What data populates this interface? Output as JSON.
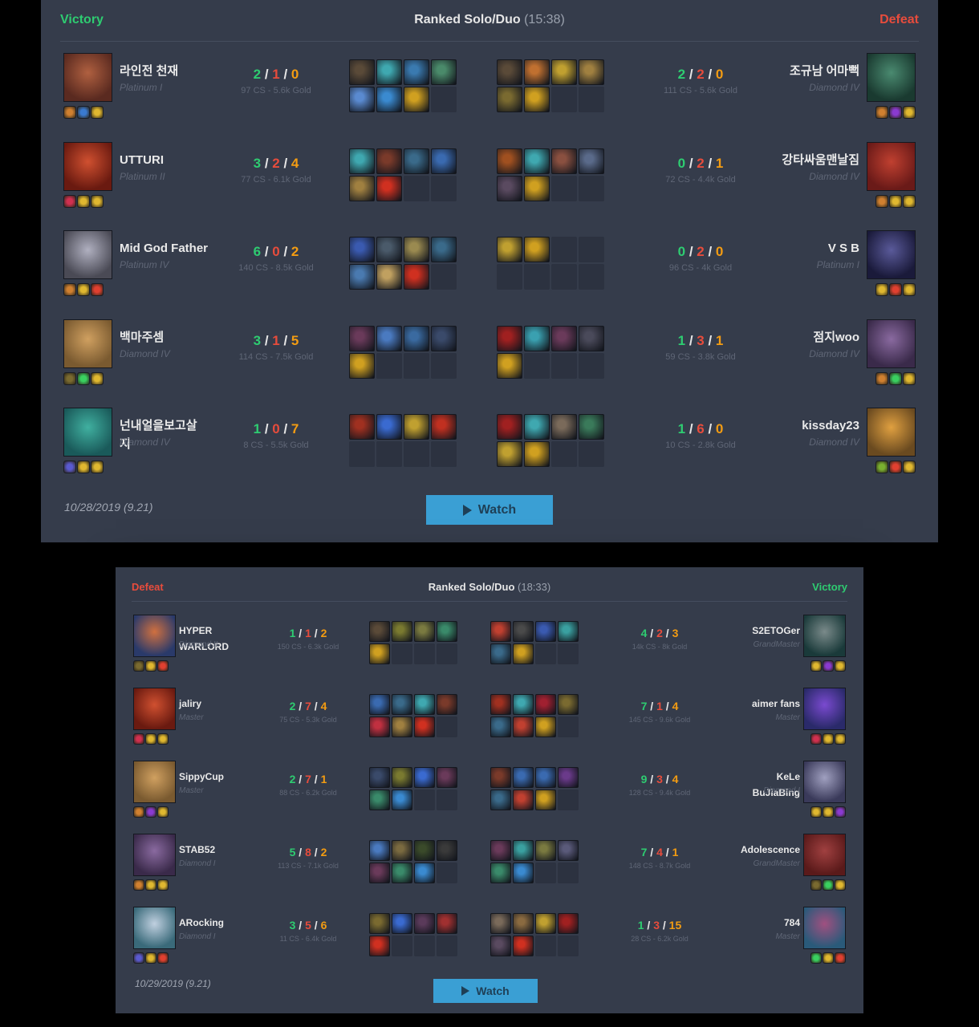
{
  "matches": [
    {
      "result_left": "Victory",
      "result_right": "Defeat",
      "left_win": true,
      "queue": "Ranked Solo/Duo",
      "duration": "(15:38)",
      "date": "10/28/2019 (9.21)",
      "watch_label": "Watch",
      "rows": [
        {
          "left": {
            "name": "라인전 천재",
            "rank": "Platinum I",
            "kills": "2",
            "deaths": "1",
            "assists": "0",
            "cs_gold": "97 CS - 5.6k Gold",
            "avatar_colors": [
              "#5a2a20",
              "#b06040"
            ],
            "summoners": [
              "#d08030",
              "#3a7ad0",
              "#e0b830"
            ],
            "items": [
              "#5a4a38",
              "#3fa8b0",
              "#3a7ab0",
              "#4a8a6a",
              "#5a8ad0",
              "#3a8ad0",
              "#d0a020",
              "",
              ""
            ]
          },
          "right": {
            "name": "조규남 어마뻑",
            "rank": "Diamond IV",
            "kills": "2",
            "deaths": "2",
            "assists": "0",
            "cs_gold": "111 CS - 5.6k Gold",
            "avatar_colors": [
              "#1a3a30",
              "#4a8a70"
            ],
            "summoners": [
              "#d08030",
              "#8a3ad0",
              "#e0b830"
            ],
            "items": [
              "#5a4a38",
              "#c07030",
              "#c0a030",
              "#a08040",
              "#7a6a30",
              "#d0a020",
              "",
              ""
            ]
          }
        },
        {
          "left": {
            "name": "UTTURI",
            "rank": "Platinum II",
            "kills": "3",
            "deaths": "2",
            "assists": "4",
            "cs_gold": "77 CS - 6.1k Gold",
            "avatar_colors": [
              "#6a1a10",
              "#d05030"
            ],
            "summoners": [
              "#d03050",
              "#e0b830",
              "#e0b830"
            ],
            "items": [
              "#3fa8b0",
              "#7a3a2a",
              "#3a6a8a",
              "#3a6ab0",
              "#a08040",
              "#d03020",
              "",
              ""
            ]
          },
          "right": {
            "name": "강타싸움맨날짐",
            "rank": "Diamond IV",
            "kills": "0",
            "deaths": "2",
            "assists": "1",
            "cs_gold": "72 CS - 4.4k Gold",
            "avatar_colors": [
              "#6a1a18",
              "#c04030"
            ],
            "summoners": [
              "#d08030",
              "#e0b830",
              "#e0b830"
            ],
            "items": [
              "#a05020",
              "#3fa8b0",
              "#8a5040",
              "#5a6a8a",
              "#5a4a60",
              "#d0a020",
              "",
              ""
            ]
          }
        },
        {
          "left": {
            "name": "Mid God Father",
            "rank": "Platinum IV",
            "kills": "6",
            "deaths": "0",
            "assists": "2",
            "cs_gold": "140 CS - 8.5k Gold",
            "avatar_colors": [
              "#4a4a55",
              "#b0b0c0"
            ],
            "summoners": [
              "#d08030",
              "#e0b830",
              "#e04030"
            ],
            "items": [
              "#3a5ab0",
              "#4a5a6a",
              "#9a8a50",
              "#3a6a8a",
              "#4a7ab0",
              "#c0a060",
              "#d03020",
              ""
            ]
          },
          "right": {
            "name": "V S B",
            "rank": "Platinum I",
            "kills": "0",
            "deaths": "2",
            "assists": "0",
            "cs_gold": "96 CS - 4k Gold",
            "avatar_colors": [
              "#1a1a3a",
              "#5a5a9a"
            ],
            "summoners": [
              "#e0b830",
              "#e04030",
              "#e0b830"
            ],
            "items": [
              "#c0a030",
              "#d0a020",
              "",
              "",
              "",
              "",
              "",
              ""
            ]
          }
        },
        {
          "left": {
            "name": "백마주셈",
            "rank": "Diamond IV",
            "kills": "3",
            "deaths": "1",
            "assists": "5",
            "cs_gold": "114 CS - 7.5k Gold",
            "avatar_colors": [
              "#7a5a30",
              "#d0a060"
            ],
            "summoners": [
              "#7a6a30",
              "#3ad060",
              "#e0b830"
            ],
            "items": [
              "#6a3a5a",
              "#4a7ac0",
              "#3a6aa0",
              "#3a4a6a",
              "#d0a020",
              "",
              "",
              ""
            ]
          },
          "right": {
            "name": "점지woo",
            "rank": "Diamond IV",
            "kills": "1",
            "deaths": "3",
            "assists": "1",
            "cs_gold": "59 CS - 3.8k Gold",
            "avatar_colors": [
              "#3a2a4a",
              "#8a6aa0"
            ],
            "summoners": [
              "#d08030",
              "#3ad060",
              "#e0b830"
            ],
            "items": [
              "#a02020",
              "#3aa0b0",
              "#6a3a5a",
              "#4a4a5a",
              "#d0a020",
              "",
              "",
              ""
            ]
          }
        },
        {
          "left": {
            "name": "넌내얼을보고살지",
            "rank": "Diamond IV",
            "kills": "1",
            "deaths": "0",
            "assists": "7",
            "cs_gold": "8 CS - 5.5k Gold",
            "avatar_colors": [
              "#1a5a5a",
              "#40b0a0"
            ],
            "summoners": [
              "#5a5ad0",
              "#e0b830",
              "#e0b830"
            ],
            "items": [
              "#a03020",
              "#3a6ad0",
              "#c0a030",
              "#c03020",
              "",
              "",
              "",
              ""
            ]
          },
          "right": {
            "name": "kissday23",
            "rank": "Diamond IV",
            "kills": "1",
            "deaths": "6",
            "assists": "0",
            "cs_gold": "10 CS - 2.8k Gold",
            "avatar_colors": [
              "#6a4a20",
              "#e0a040"
            ],
            "summoners": [
              "#7ab030",
              "#e04030",
              "#e0b830"
            ],
            "items": [
              "#a02020",
              "#3fa8b0",
              "#7a6a5a",
              "#3a7a5a",
              "#c0a030",
              "#d0a020",
              "",
              ""
            ]
          }
        }
      ]
    },
    {
      "result_left": "Defeat",
      "result_right": "Victory",
      "left_win": false,
      "queue": "Ranked Solo/Duo",
      "duration": "(18:33)",
      "date": "10/29/2019 (9.21)",
      "watch_label": "Watch",
      "rows": [
        {
          "left": {
            "name": "HYPER WARLORD",
            "rank": "Diamond II",
            "kills": "1",
            "deaths": "1",
            "assists": "2",
            "cs_gold": "150 CS - 6.3k Gold",
            "avatar_colors": [
              "#2a3a6a",
              "#d07040"
            ],
            "summoners": [
              "#7a6a30",
              "#e0b830",
              "#e04030"
            ],
            "items": [
              "#5a4a38",
              "#7a7a30",
              "#7a7a40",
              "#3a8a6a",
              "#d0a020",
              "",
              "",
              ""
            ]
          },
          "right": {
            "name": "S2ETOGer",
            "rank": "GrandMaster",
            "kills": "4",
            "deaths": "2",
            "assists": "3",
            "cs_gold": "14k CS - 8k Gold",
            "avatar_colors": [
              "#1a3a3a",
              "#7a8a8a"
            ],
            "summoners": [
              "#e0b830",
              "#8a3ad0",
              "#e0b830"
            ],
            "items": [
              "#c04030",
              "#4a4a4a",
              "#3a5ab0",
              "#3aa0a0",
              "#3a6a8a",
              "#d0a020",
              "",
              ""
            ]
          }
        },
        {
          "left": {
            "name": "jaliry",
            "rank": "Master",
            "kills": "2",
            "deaths": "7",
            "assists": "4",
            "cs_gold": "75 CS - 5.3k Gold",
            "avatar_colors": [
              "#6a1a10",
              "#d05030"
            ],
            "summoners": [
              "#d03050",
              "#e0b830",
              "#e0b830"
            ],
            "items": [
              "#3a6ab0",
              "#3a6a8a",
              "#3fa8b0",
              "#7a3a2a",
              "#c03040",
              "#a08040",
              "#d03020",
              ""
            ]
          },
          "right": {
            "name": "aimer fans",
            "rank": "Master",
            "kills": "7",
            "deaths": "1",
            "assists": "4",
            "cs_gold": "145 CS - 9.6k Gold",
            "avatar_colors": [
              "#2a2a6a",
              "#7a4ad0"
            ],
            "summoners": [
              "#d03050",
              "#e0b830",
              "#e0b830"
            ],
            "items": [
              "#a03020",
              "#3fa8b0",
              "#a02030",
              "#7a6a30",
              "#3a6a8a",
              "#c04030",
              "#d0a020",
              ""
            ]
          }
        },
        {
          "left": {
            "name": "SippyCup",
            "rank": "Master",
            "kills": "2",
            "deaths": "7",
            "assists": "1",
            "cs_gold": "88 CS - 6.2k Gold",
            "avatar_colors": [
              "#7a5a30",
              "#d0a060"
            ],
            "summoners": [
              "#d08030",
              "#8a3ad0",
              "#e0b830"
            ],
            "items": [
              "#3a4a6a",
              "#7a7a30",
              "#3a6ad0",
              "#6a3a5a",
              "#3a8a6a",
              "#3a8ad0",
              "",
              ""
            ]
          },
          "right": {
            "name": "KeLe BuJiaBing",
            "rank": "Diamond I",
            "kills": "9",
            "deaths": "3",
            "assists": "4",
            "cs_gold": "128 CS - 9.4k Gold",
            "avatar_colors": [
              "#3a3a5a",
              "#a0a0c0"
            ],
            "summoners": [
              "#e0b830",
              "#e0b830",
              "#8a3ad0"
            ],
            "items": [
              "#7a3a2a",
              "#3a6ab0",
              "#3a6ab0",
              "#6a3a8a",
              "#3a6a8a",
              "#c04030",
              "#d0a020",
              ""
            ]
          }
        },
        {
          "left": {
            "name": "STAB52",
            "rank": "Diamond I",
            "kills": "5",
            "deaths": "8",
            "assists": "2",
            "cs_gold": "113 CS - 7.1k Gold",
            "avatar_colors": [
              "#3a2a4a",
              "#8a6aa0"
            ],
            "summoners": [
              "#d08030",
              "#e0b830",
              "#e0b830"
            ],
            "items": [
              "#4a7ac0",
              "#7a6a40",
              "#3a4a2a",
              "#3a3a3a",
              "#6a3a5a",
              "#3a8a6a",
              "#3a8ad0",
              ""
            ]
          },
          "right": {
            "name": "Adolescence",
            "rank": "GrandMaster",
            "kills": "7",
            "deaths": "4",
            "assists": "1",
            "cs_gold": "148 CS - 8.7k Gold",
            "avatar_colors": [
              "#5a1a1a",
              "#a04040"
            ],
            "summoners": [
              "#7a6a30",
              "#3ad060",
              "#e0b830"
            ],
            "items": [
              "#6a3a5a",
              "#3aa0a0",
              "#7a7a40",
              "#5a5a7a",
              "#3a8a6a",
              "#3a8ad0",
              "",
              ""
            ]
          }
        },
        {
          "left": {
            "name": "ARocking",
            "rank": "Diamond I",
            "kills": "3",
            "deaths": "5",
            "assists": "6",
            "cs_gold": "11 CS - 6.4k Gold",
            "avatar_colors": [
              "#3a6a7a",
              "#c0d0e0"
            ],
            "summoners": [
              "#5a5ad0",
              "#e0b830",
              "#e04030"
            ],
            "items": [
              "#7a6a30",
              "#3a6ad0",
              "#5a3a5a",
              "#a03030",
              "#d03020",
              "",
              "",
              ""
            ]
          },
          "right": {
            "name": "784",
            "rank": "Master",
            "kills": "1",
            "deaths": "3",
            "assists": "15",
            "cs_gold": "28 CS - 6.2k Gold",
            "avatar_colors": [
              "#2a5a7a",
              "#a05080"
            ],
            "summoners": [
              "#3ad060",
              "#e0b830",
              "#e04030"
            ],
            "items": [
              "#7a6a5a",
              "#8a6a40",
              "#c0a030",
              "#a02020",
              "#5a4a60",
              "#d03020",
              "",
              ""
            ]
          }
        }
      ]
    }
  ]
}
